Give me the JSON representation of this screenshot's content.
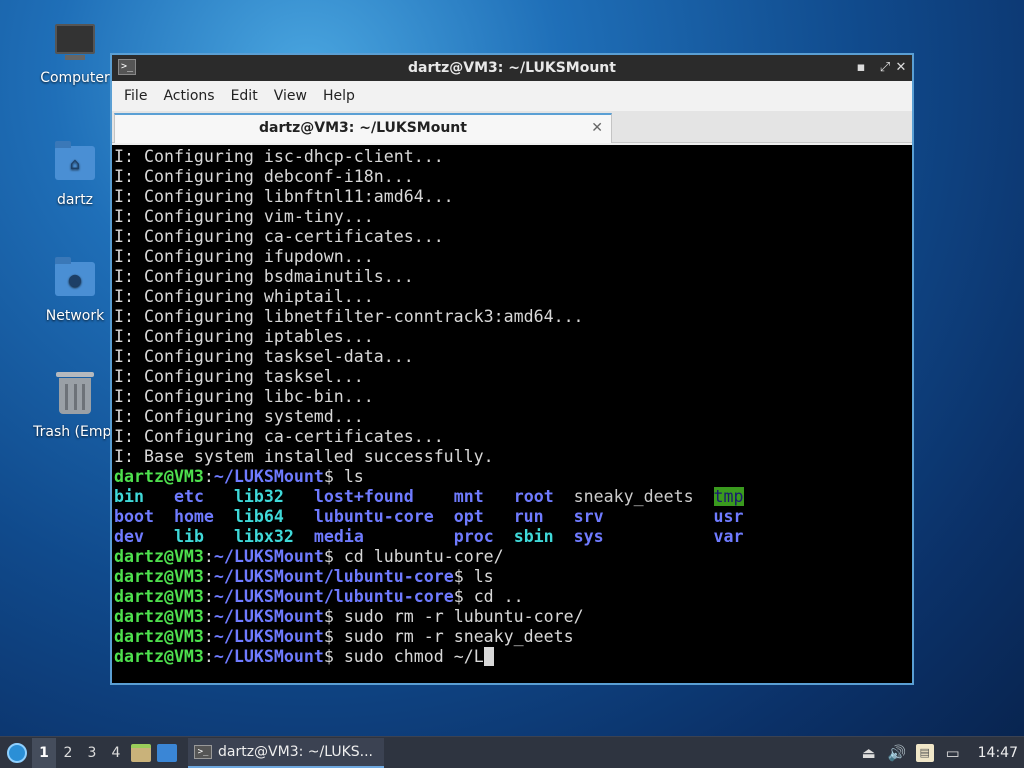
{
  "desktop": {
    "icons": [
      {
        "label": "Computer"
      },
      {
        "label": "dartz"
      },
      {
        "label": "Network"
      },
      {
        "label": "Trash (Empt"
      }
    ]
  },
  "window": {
    "title": "dartz@VM3: ~/LUKSMount",
    "controls": {
      "minimize": "▪",
      "restore": "⤢",
      "close": "✕"
    },
    "menu": [
      "File",
      "Actions",
      "Edit",
      "View",
      "Help"
    ],
    "tab": {
      "label": "dartz@VM3: ~/LUKSMount",
      "close": "✕"
    }
  },
  "terminal": {
    "output_lines": [
      "I: Configuring isc-dhcp-client...",
      "I: Configuring debconf-i18n...",
      "I: Configuring libnftnl11:amd64...",
      "I: Configuring vim-tiny...",
      "I: Configuring ca-certificates...",
      "I: Configuring ifupdown...",
      "I: Configuring bsdmainutils...",
      "I: Configuring whiptail...",
      "I: Configuring libnetfilter-conntrack3:amd64...",
      "I: Configuring iptables...",
      "I: Configuring tasksel-data...",
      "I: Configuring tasksel...",
      "I: Configuring libc-bin...",
      "I: Configuring systemd...",
      "I: Configuring ca-certificates...",
      "I: Base system installed successfully."
    ],
    "prompt_user": "dartz@VM3",
    "ls_output": [
      [
        "bin",
        "etc",
        "lib32",
        "lost+found",
        "mnt",
        "root",
        "sneaky_deets",
        "tmp"
      ],
      [
        "boot",
        "home",
        "lib64",
        "lubuntu-core",
        "opt",
        "run",
        "srv",
        "usr"
      ],
      [
        "dev",
        "lib",
        "libx32",
        "media",
        "proc",
        "sbin",
        "sys",
        "var"
      ]
    ],
    "commands": [
      {
        "path": "~/LUKSMount",
        "cmd": " ls"
      },
      {
        "path": "~/LUKSMount",
        "cmd": " cd lubuntu-core/"
      },
      {
        "path": "~/LUKSMount/lubuntu-core",
        "cmd": " ls"
      },
      {
        "path": "~/LUKSMount/lubuntu-core",
        "cmd": " cd .."
      },
      {
        "path": "~/LUKSMount",
        "cmd": " sudo rm -r lubuntu-core/"
      },
      {
        "path": "~/LUKSMount",
        "cmd": " sudo rm -r sneaky_deets"
      },
      {
        "path": "~/LUKSMount",
        "cmd": " sudo chmod ~/L"
      }
    ]
  },
  "taskbar": {
    "workspaces": [
      "1",
      "2",
      "3",
      "4"
    ],
    "active_workspace": "1",
    "task_label": "dartz@VM3: ~/LUKS...",
    "clock": "14:47",
    "tray_icons": [
      "storage-icon",
      "volume-icon",
      "clipboard-icon",
      "display-icon"
    ]
  },
  "colors": {
    "prompt_user": "#4ee04e",
    "prompt_path": "#6f7bff",
    "window_border": "#5a9fd4"
  }
}
